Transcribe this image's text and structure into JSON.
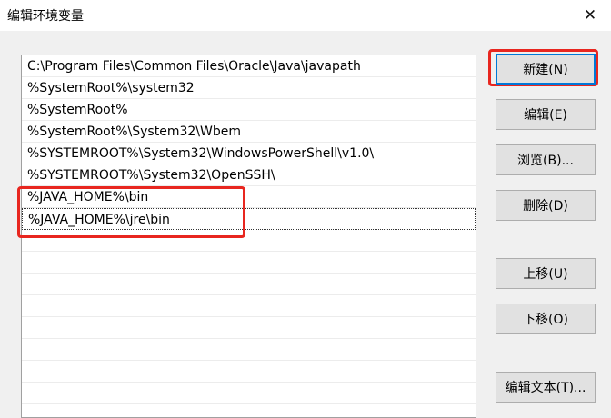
{
  "window": {
    "title": "编辑环境变量",
    "close_glyph": "✕"
  },
  "path_list": {
    "items": [
      "C:\\Program Files\\Common Files\\Oracle\\Java\\javapath",
      "%SystemRoot%\\system32",
      "%SystemRoot%",
      "%SystemRoot%\\System32\\Wbem",
      "%SYSTEMROOT%\\System32\\WindowsPowerShell\\v1.0\\",
      "%SYSTEMROOT%\\System32\\OpenSSH\\",
      "%JAVA_HOME%\\bin",
      "%JAVA_HOME%\\jre\\bin",
      "",
      "",
      "",
      "",
      "",
      "",
      "",
      ""
    ],
    "selected_index": 7
  },
  "buttons": {
    "new": "新建(N)",
    "edit": "编辑(E)",
    "browse": "浏览(B)...",
    "delete": "删除(D)",
    "move_up": "上移(U)",
    "move_down": "下移(O)",
    "edit_text": "编辑文本(T)..."
  },
  "colors": {
    "annotation_red": "#e8261f",
    "focus_blue": "#0078d7"
  }
}
